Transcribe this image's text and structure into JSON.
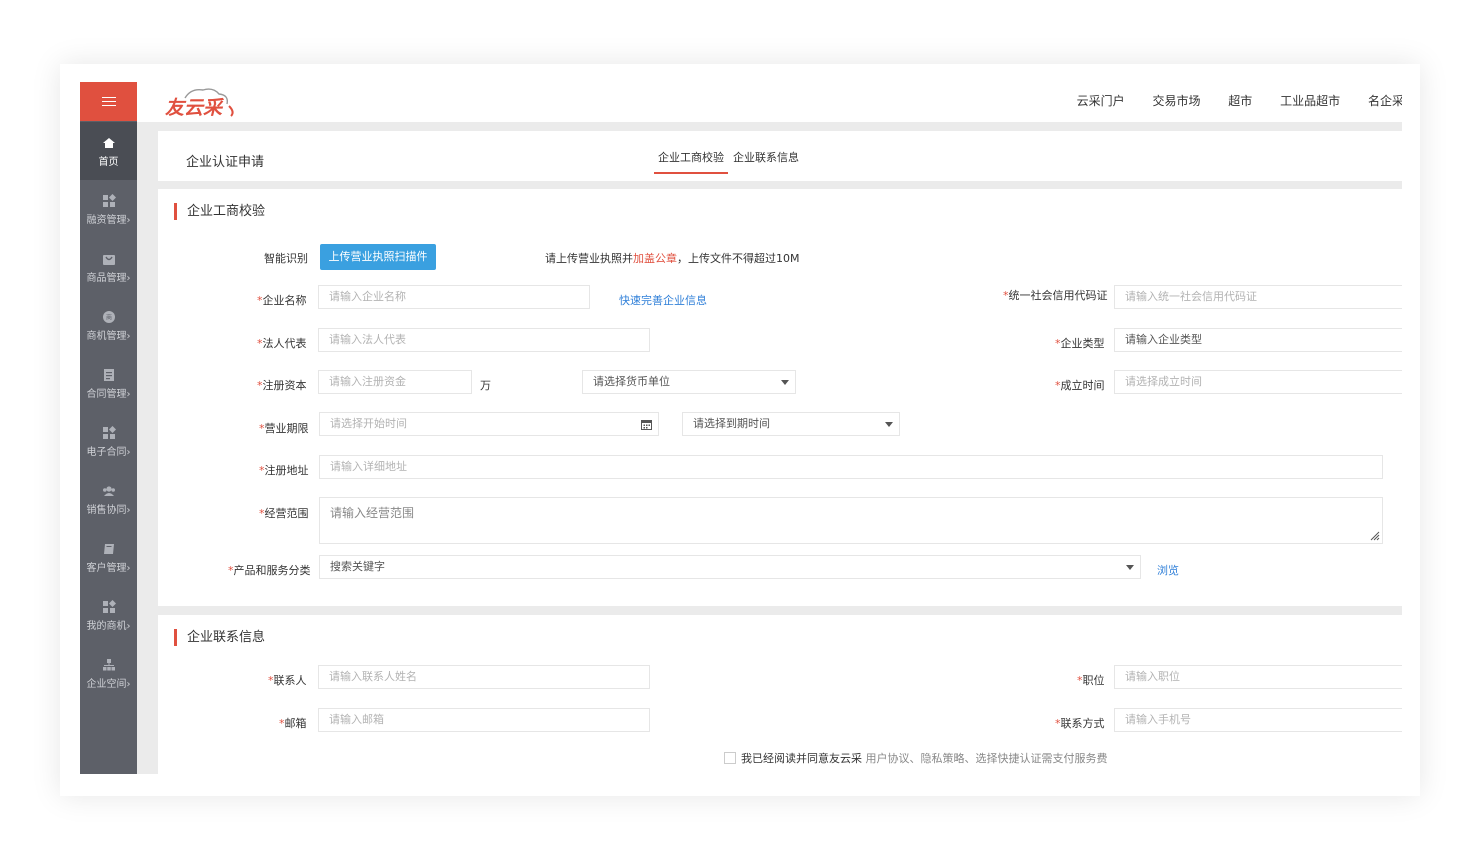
{
  "colors": {
    "accent": "#e0503f",
    "sidebar": "#5d6068",
    "button": "#3aa0e0",
    "link": "#2f7fd8"
  },
  "app": {
    "logo_text": "友云采"
  },
  "sidebar": {
    "items": [
      {
        "label": "首页",
        "icon": "home-icon"
      },
      {
        "label": "融资管理›",
        "icon": "grid-icon"
      },
      {
        "label": "商品管理›",
        "icon": "bag-icon"
      },
      {
        "label": "商机管理›",
        "icon": "opportunity-icon"
      },
      {
        "label": "合同管理›",
        "icon": "contract-icon"
      },
      {
        "label": "电子合同›",
        "icon": "grid-icon"
      },
      {
        "label": "销售协同›",
        "icon": "people-icon"
      },
      {
        "label": "客户管理›",
        "icon": "book-icon"
      },
      {
        "label": "我的商机›",
        "icon": "grid-icon"
      },
      {
        "label": "企业空间›",
        "icon": "org-icon"
      }
    ]
  },
  "topnav": [
    "云采门户",
    "交易市场",
    "超市",
    "工业品超市",
    "名企采"
  ],
  "header": {
    "title": "企业认证申请",
    "tabs": [
      "企业工商校验",
      "企业联系信息"
    ]
  },
  "business": {
    "title": "企业工商校验",
    "smart_label": "智能识别",
    "upload_button": "上传营业执照扫描件",
    "hint_prefix": "请上传营业执照并",
    "hint_red": "加盖公章",
    "hint_suffix": "，上传文件不得超过10M",
    "req": "*",
    "company_name": {
      "label": "企业名称",
      "placeholder": "请输入企业名称"
    },
    "quick_link": "快速完善企业信息",
    "credit_code": {
      "label": "统一社会信用代码证",
      "placeholder": "请输入统一社会信用代码证"
    },
    "legal_rep": {
      "label": "法人代表",
      "placeholder": "请输入法人代表"
    },
    "company_type": {
      "label": "企业类型",
      "placeholder": "请输入企业类型"
    },
    "capital": {
      "label": "注册资本",
      "placeholder": "请输入注册资金",
      "unit": "万",
      "currency_placeholder": "请选择货币单位"
    },
    "established": {
      "label": "成立时间",
      "placeholder": "请选择成立时间"
    },
    "period": {
      "label": "营业期限",
      "start_placeholder": "请选择开始时间",
      "end_placeholder": "请选择到期时间"
    },
    "address": {
      "label": "注册地址",
      "placeholder": "请输入详细地址"
    },
    "scope": {
      "label": "经营范围",
      "placeholder": "请输入经营范围"
    },
    "category": {
      "label": "产品和服务分类",
      "placeholder": "搜索关键字",
      "browse": "浏览"
    }
  },
  "contact": {
    "title": "企业联系信息",
    "person": {
      "label": "联系人",
      "placeholder": "请输入联系人姓名"
    },
    "position": {
      "label": "职位",
      "placeholder": "请输入职位"
    },
    "email": {
      "label": "邮箱",
      "placeholder": "请输入邮箱"
    },
    "phone": {
      "label": "联系方式",
      "placeholder": "请输入手机号"
    },
    "agree_text": "我已经阅读并同意友云采",
    "agree_links": "用户协议、隐私策略、选择快捷认证需支付服务费"
  }
}
